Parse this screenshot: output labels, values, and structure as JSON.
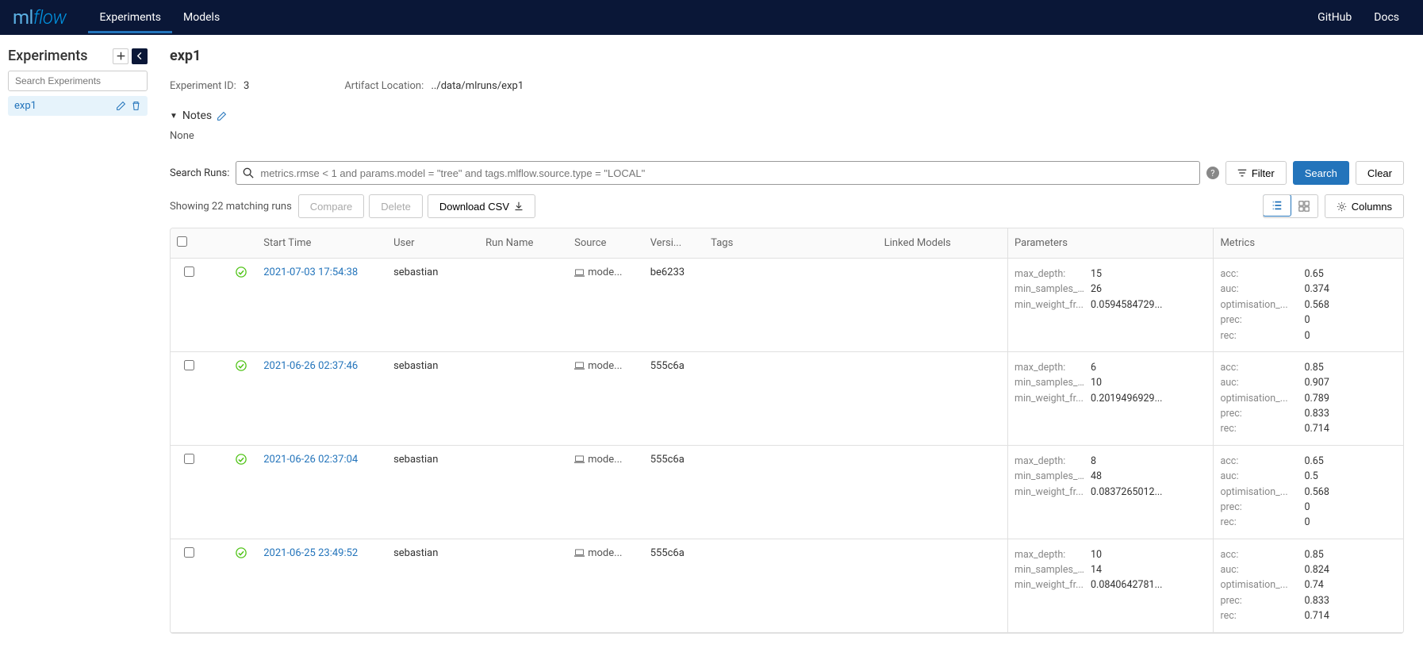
{
  "header": {
    "logo_ml": "ml",
    "logo_flow": "flow",
    "nav": {
      "experiments": "Experiments",
      "models": "Models"
    },
    "right": {
      "github": "GitHub",
      "docs": "Docs"
    }
  },
  "sidebar": {
    "title": "Experiments",
    "search_placeholder": "Search Experiments",
    "items": [
      {
        "name": "exp1",
        "active": true
      }
    ]
  },
  "experiment": {
    "title": "exp1",
    "id_label": "Experiment ID:",
    "id_value": "3",
    "artifact_label": "Artifact Location:",
    "artifact_value": "../data/mlruns/exp1",
    "notes_label": "Notes",
    "notes_body": "None"
  },
  "search": {
    "label": "Search Runs:",
    "placeholder": "metrics.rmse < 1 and params.model = \"tree\" and tags.mlflow.source.type = \"LOCAL\"",
    "filter": "Filter",
    "search_btn": "Search",
    "clear": "Clear"
  },
  "toolbar": {
    "showing": "Showing 22 matching runs",
    "compare": "Compare",
    "delete": "Delete",
    "download": "Download CSV",
    "columns": "Columns"
  },
  "table": {
    "headers": {
      "start": "Start Time",
      "user": "User",
      "run_name": "Run Name",
      "source": "Source",
      "version": "Versi...",
      "tags": "Tags",
      "linked": "Linked Models",
      "parameters": "Parameters",
      "metrics": "Metrics"
    },
    "rows": [
      {
        "start_time": "2021-07-03 17:54:38",
        "user": "sebastian",
        "source": "mode...",
        "version": "be6233",
        "params": [
          {
            "k": "max_depth:",
            "v": "15"
          },
          {
            "k": "min_samples_l...",
            "v": "26"
          },
          {
            "k": "min_weight_fr...",
            "v": "0.0594584729..."
          }
        ],
        "metrics": [
          {
            "k": "acc:",
            "v": "0.65"
          },
          {
            "k": "auc:",
            "v": "0.374"
          },
          {
            "k": "optimisation_...",
            "v": "0.568"
          },
          {
            "k": "prec:",
            "v": "0"
          },
          {
            "k": "rec:",
            "v": "0"
          }
        ]
      },
      {
        "start_time": "2021-06-26 02:37:46",
        "user": "sebastian",
        "source": "mode...",
        "version": "555c6a",
        "params": [
          {
            "k": "max_depth:",
            "v": "6"
          },
          {
            "k": "min_samples_l...",
            "v": "10"
          },
          {
            "k": "min_weight_fr...",
            "v": "0.2019496929..."
          }
        ],
        "metrics": [
          {
            "k": "acc:",
            "v": "0.85"
          },
          {
            "k": "auc:",
            "v": "0.907"
          },
          {
            "k": "optimisation_...",
            "v": "0.789"
          },
          {
            "k": "prec:",
            "v": "0.833"
          },
          {
            "k": "rec:",
            "v": "0.714"
          }
        ]
      },
      {
        "start_time": "2021-06-26 02:37:04",
        "user": "sebastian",
        "source": "mode...",
        "version": "555c6a",
        "params": [
          {
            "k": "max_depth:",
            "v": "8"
          },
          {
            "k": "min_samples_l...",
            "v": "48"
          },
          {
            "k": "min_weight_fr...",
            "v": "0.0837265012..."
          }
        ],
        "metrics": [
          {
            "k": "acc:",
            "v": "0.65"
          },
          {
            "k": "auc:",
            "v": "0.5"
          },
          {
            "k": "optimisation_...",
            "v": "0.568"
          },
          {
            "k": "prec:",
            "v": "0"
          },
          {
            "k": "rec:",
            "v": "0"
          }
        ]
      },
      {
        "start_time": "2021-06-25 23:49:52",
        "user": "sebastian",
        "source": "mode...",
        "version": "555c6a",
        "params": [
          {
            "k": "max_depth:",
            "v": "10"
          },
          {
            "k": "min_samples_l...",
            "v": "14"
          },
          {
            "k": "min_weight_fr...",
            "v": "0.0840642781..."
          }
        ],
        "metrics": [
          {
            "k": "acc:",
            "v": "0.85"
          },
          {
            "k": "auc:",
            "v": "0.824"
          },
          {
            "k": "optimisation_...",
            "v": "0.74"
          },
          {
            "k": "prec:",
            "v": "0.833"
          },
          {
            "k": "rec:",
            "v": "0.714"
          }
        ]
      }
    ]
  }
}
